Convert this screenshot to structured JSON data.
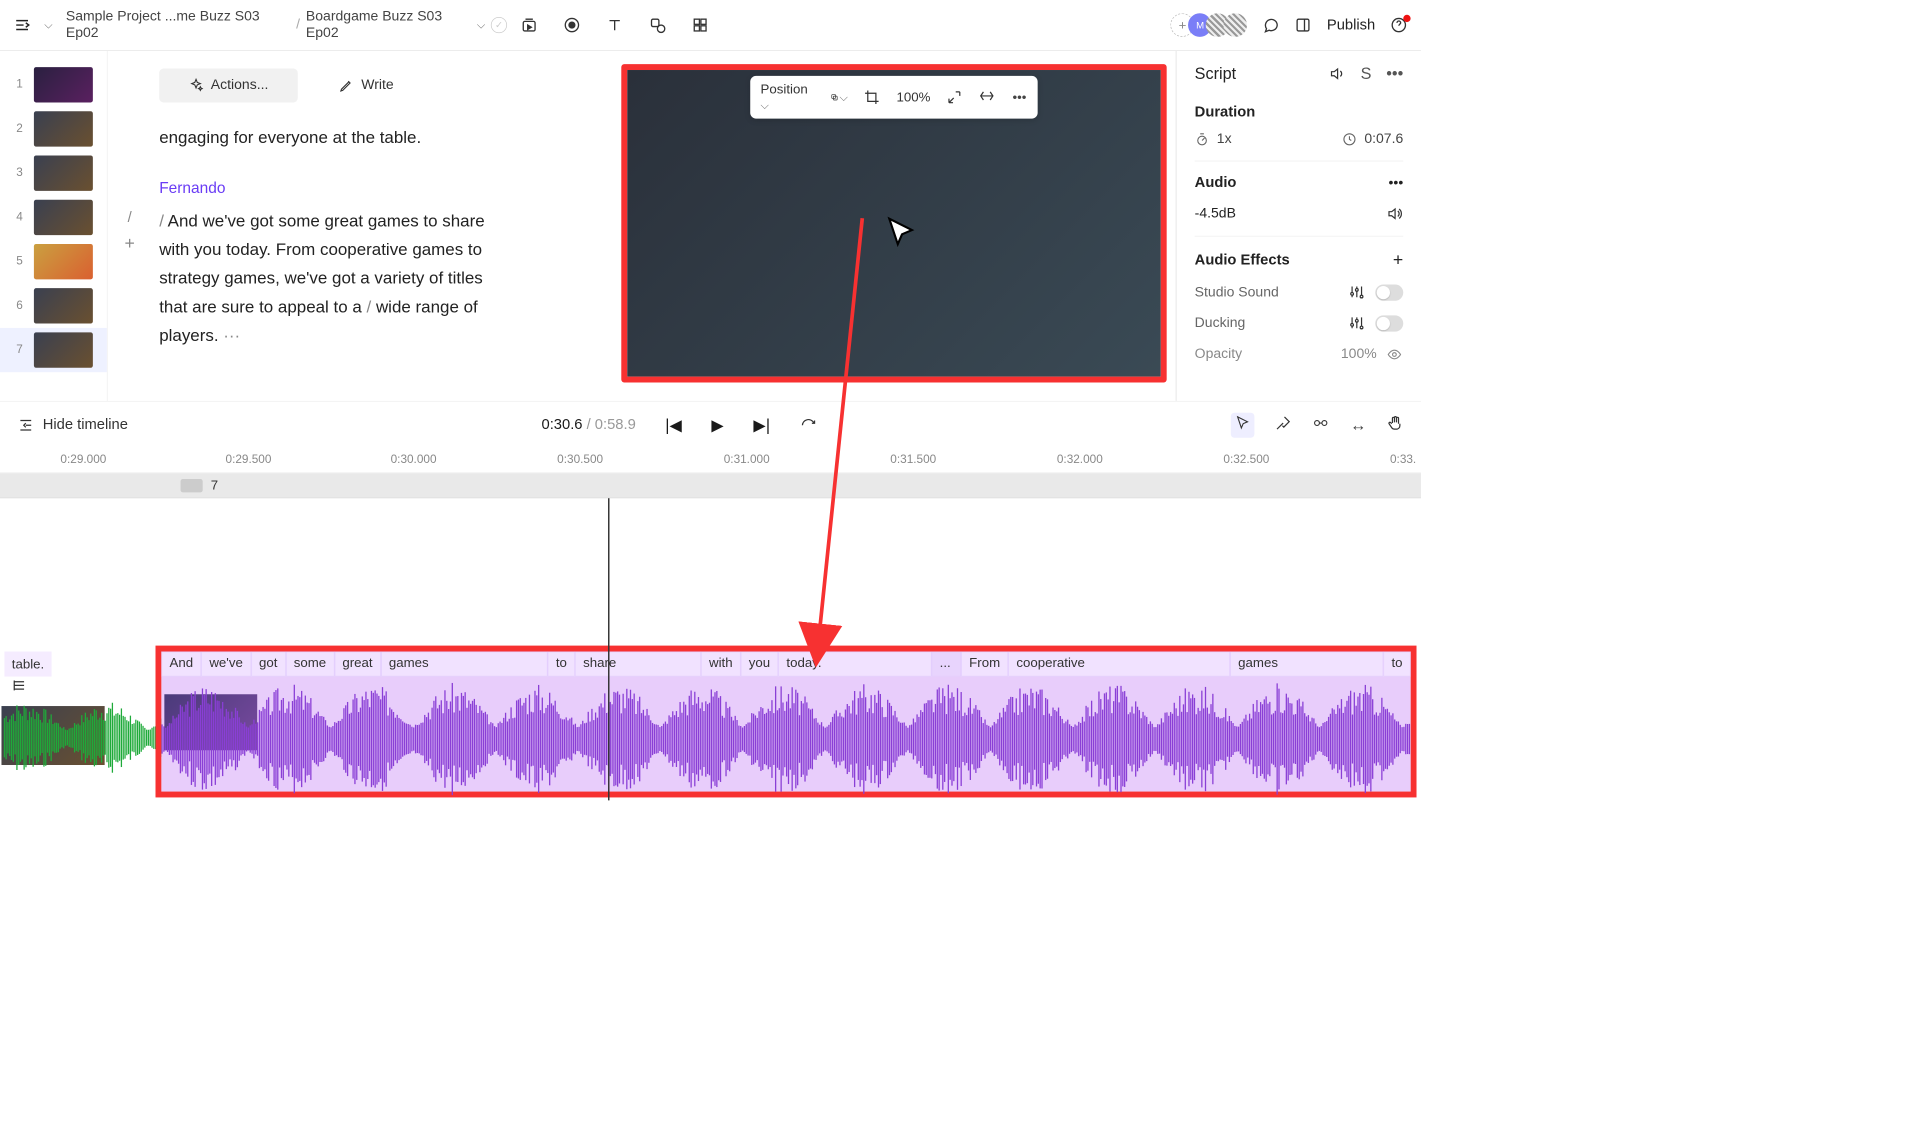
{
  "breadcrumb": {
    "seg1": "Sample Project ...me Buzz S03 Ep02",
    "seg2": "Boardgame Buzz S03 Ep02"
  },
  "topTools": {
    "positionLabel": "Position",
    "zoom": "100%"
  },
  "publish": "Publish",
  "thumbs": [
    "1",
    "2",
    "3",
    "4",
    "5",
    "6",
    "7"
  ],
  "editor": {
    "actions": "Actions...",
    "write": "Write",
    "line1": "engaging for everyone at the table.",
    "speaker": "Fernando",
    "body": "And we've got some great games to share with you today. From cooperative games to strategy games, we've got a variety of titles that are sure to appeal to a",
    "bodyTail": "wide range of players."
  },
  "inspector": {
    "title": "Script",
    "durationLabel": "Duration",
    "speed": "1x",
    "duration": "0:07.6",
    "audioLabel": "Audio",
    "audioVal": "-4.5dB",
    "effectsLabel": "Audio Effects",
    "studio": "Studio Sound",
    "ducking": "Ducking",
    "opacityLabel": "Opacity",
    "opacityVal": "100%"
  },
  "transport": {
    "hide": "Hide timeline",
    "cur": "0:30.6",
    "sep": "/",
    "tot": "0:58.9"
  },
  "ruler": [
    "0:29.000",
    "0:29.500",
    "0:30.000",
    "0:30.500",
    "0:31.000",
    "0:31.500",
    "0:32.000",
    "0:32.500",
    "0:33."
  ],
  "clipNum": "7",
  "preWord": "table.",
  "words": [
    "And",
    "we've",
    "got",
    "some",
    "great",
    "games",
    "to",
    "share",
    "with",
    "you",
    "today.",
    "...",
    "From",
    "cooperative",
    "games",
    "to"
  ]
}
